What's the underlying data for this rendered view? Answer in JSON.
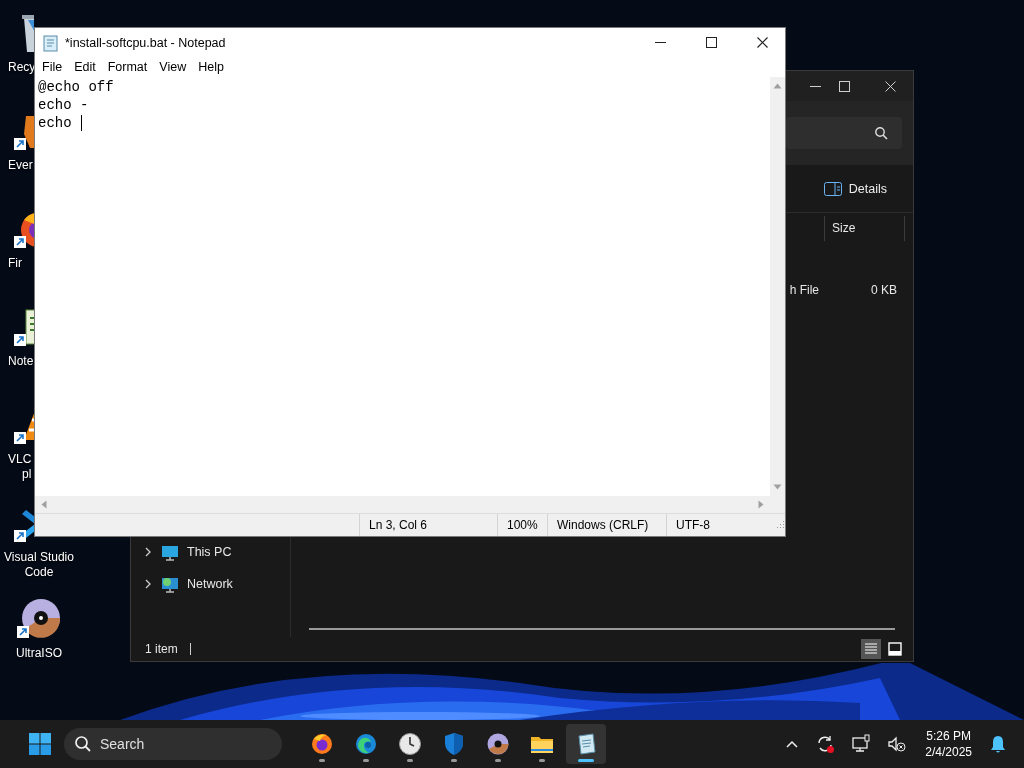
{
  "desktop_icons": [
    {
      "kind": "recycle-bin",
      "lines": [
        "Recy"
      ]
    },
    {
      "kind": "evernote",
      "lines": [
        "Ever"
      ]
    },
    {
      "kind": "firefox",
      "lines": [
        "Fir"
      ]
    },
    {
      "kind": "notepad",
      "lines": [
        "Note"
      ]
    },
    {
      "kind": "vlc",
      "lines": [
        "VLC",
        "pl"
      ]
    },
    {
      "kind": "vscode",
      "lines": [
        "Visual Studio",
        "Code"
      ]
    },
    {
      "kind": "disc",
      "lines": [
        "UltraISO"
      ]
    }
  ],
  "explorer": {
    "details_button": "Details",
    "columns": [
      "Size"
    ],
    "rows": [
      {
        "type": "h File",
        "size": "0 KB"
      }
    ],
    "nav": [
      {
        "label": "This PC",
        "kind": "pc",
        "expanded": false
      },
      {
        "label": "Network",
        "kind": "network",
        "expanded": false
      }
    ],
    "status": "1 item"
  },
  "notepad": {
    "title": "*install-softcpu.bat - Notepad",
    "menu": [
      "File",
      "Edit",
      "Format",
      "View",
      "Help"
    ],
    "lines": [
      "@echo off",
      "echo -",
      "echo"
    ],
    "status": [
      "Ln 3, Col 6",
      "100%",
      "Windows (CRLF)",
      "UTF-8"
    ]
  },
  "taskbar": {
    "search_placeholder": "Search",
    "apps": [
      {
        "kind": "firefox",
        "active": false
      },
      {
        "kind": "edge",
        "active": false
      },
      {
        "kind": "clock",
        "active": false
      },
      {
        "kind": "shield",
        "active": false
      },
      {
        "kind": "disc",
        "active": false
      },
      {
        "kind": "folder",
        "active": false
      },
      {
        "kind": "notepad",
        "active": true
      }
    ],
    "time": "5:26 PM",
    "date": "2/4/2025"
  }
}
